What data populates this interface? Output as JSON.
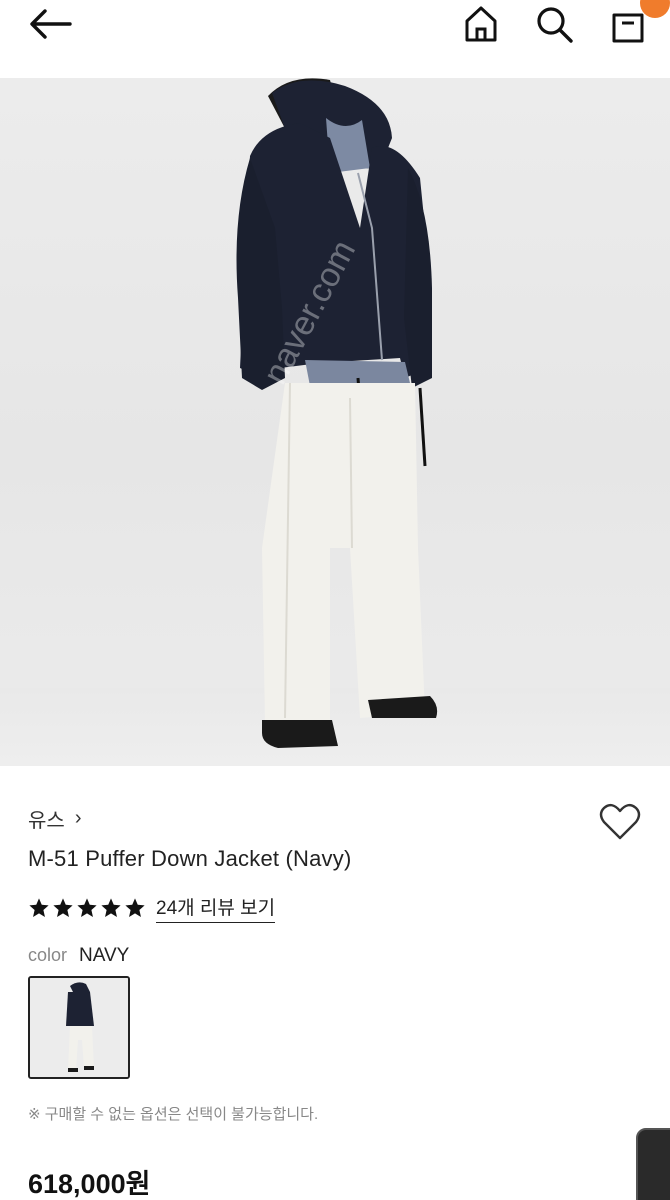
{
  "header": {
    "back_icon": "arrow-left-icon",
    "home_icon": "home-icon",
    "search_icon": "search-icon",
    "cart_icon": "cart-icon",
    "badge_color": "#f07c2c"
  },
  "product": {
    "brand": "유스",
    "brand_chevron": "›",
    "title": "M-51 Puffer Down Jacket (Navy)",
    "rating_stars": 5,
    "review_link": "24개 리뷰 보기",
    "color_label": "color",
    "color_value": "NAVY",
    "notice": "※ 구매할 수 없는 옵션은 선택이 불가능합니다.",
    "price": "618,000원",
    "watermark": "naver.com"
  },
  "colors": {
    "jacket": "#1d2233",
    "pants": "#f2f1ec",
    "accent": "#f07c2c"
  }
}
